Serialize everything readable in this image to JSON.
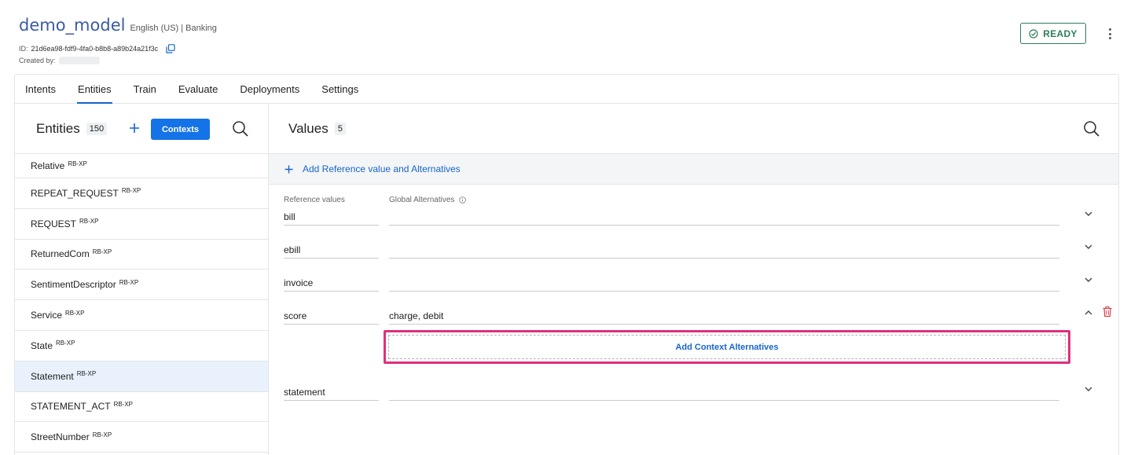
{
  "header": {
    "model_name": "demo_model",
    "model_meta": "English (US) | Banking",
    "id_label": "ID:",
    "id_value": "21d6ea98-fdf9-4fa0-b8b8-a89b24a21f3c",
    "created_label": "Created by:",
    "status": "READY"
  },
  "tabs": [
    {
      "label": "Intents"
    },
    {
      "label": "Entities",
      "active": true
    },
    {
      "label": "Train"
    },
    {
      "label": "Evaluate"
    },
    {
      "label": "Deployments"
    },
    {
      "label": "Settings"
    }
  ],
  "entities_panel": {
    "title": "Entities",
    "count": "150",
    "contexts_label": "Contexts",
    "items": [
      {
        "name": "Relative",
        "tag": "RB-XP"
      },
      {
        "name": "REPEAT_REQUEST",
        "tag": "RB-XP"
      },
      {
        "name": "REQUEST",
        "tag": "RB-XP"
      },
      {
        "name": "ReturnedCom",
        "tag": "RB-XP"
      },
      {
        "name": "SentimentDescriptor",
        "tag": "RB-XP"
      },
      {
        "name": "Service",
        "tag": "RB-XP"
      },
      {
        "name": "State",
        "tag": "RB-XP"
      },
      {
        "name": "Statement",
        "tag": "RB-XP",
        "selected": true
      },
      {
        "name": "STATEMENT_ACT",
        "tag": "RB-XP"
      },
      {
        "name": "StreetNumber",
        "tag": "RB-XP"
      }
    ]
  },
  "values_panel": {
    "title": "Values",
    "count": "5",
    "add_reference_label": "Add Reference value and Alternatives",
    "col_reference": "Reference values",
    "col_global": "Global Alternatives",
    "rows": [
      {
        "reference": "bill",
        "alternatives": ""
      },
      {
        "reference": "ebill",
        "alternatives": ""
      },
      {
        "reference": "invoice",
        "alternatives": ""
      },
      {
        "reference": "score",
        "alternatives": "charge, debit",
        "expanded": true
      },
      {
        "reference": "statement",
        "alternatives": ""
      }
    ],
    "add_context_label": "Add Context Alternatives"
  },
  "colors": {
    "accent": "#1766c9",
    "primary_button": "#1573e8",
    "ready": "#2e7d5b",
    "highlight": "#e0307b",
    "delete": "#d6404a"
  }
}
